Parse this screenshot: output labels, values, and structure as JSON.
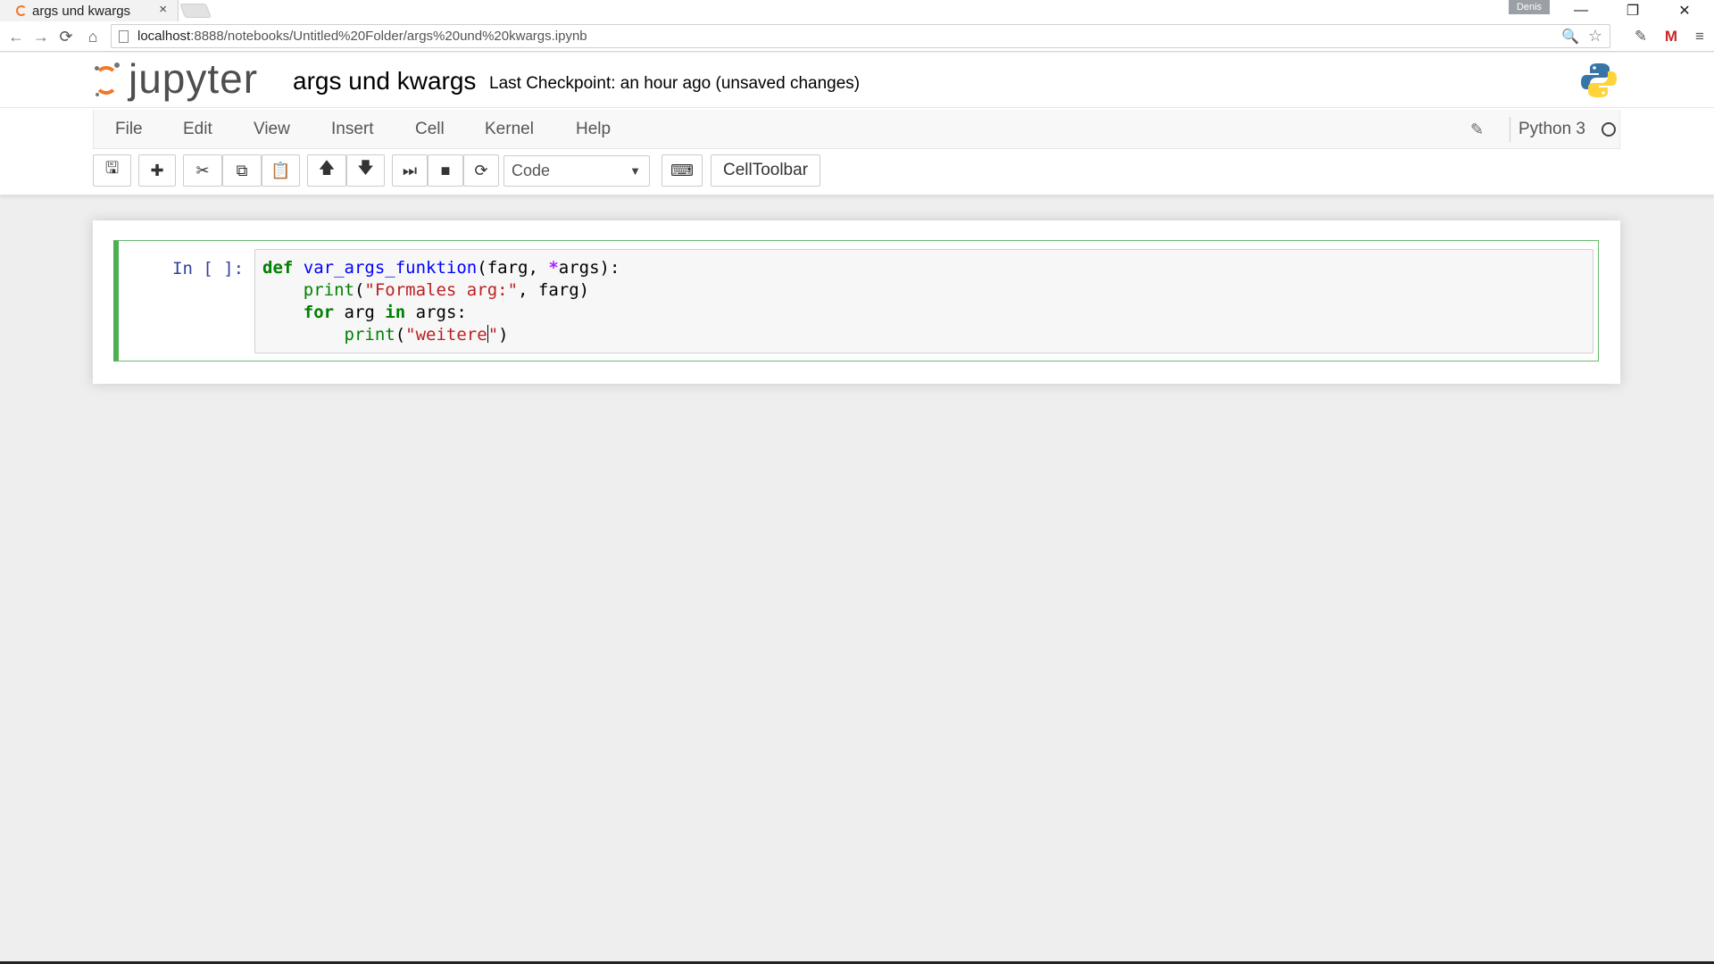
{
  "browser": {
    "tab_title": "args und kwargs",
    "tab_close": "×",
    "profile": "Denis",
    "url_host": "localhost",
    "url_rest": ":8888/notebooks/Untitled%20Folder/args%20und%20kwargs.ipynb",
    "nav_back": "←",
    "nav_forward": "→",
    "nav_reload": "⟳",
    "nav_home": "⌂",
    "win_min": "—",
    "win_restore": "❐",
    "win_close": "✕"
  },
  "header": {
    "logo_text": "jupyter",
    "notebook_name": "args und kwargs",
    "checkpoint": "Last Checkpoint: an hour ago (unsaved changes)"
  },
  "menu": {
    "items": [
      "File",
      "Edit",
      "View",
      "Insert",
      "Cell",
      "Kernel",
      "Help"
    ],
    "kernel_name": "Python 3"
  },
  "toolbar": {
    "icons": {
      "save": "🖫",
      "add": "✚",
      "cut": "✂",
      "copy": "⧉",
      "paste": "📋",
      "move_up": "🡅",
      "move_down": "🡇",
      "run": "⏭",
      "interrupt": "■",
      "restart": "⟳",
      "keyboard": "⌨"
    },
    "cell_type": "Code",
    "cell_toolbar_label": "CellToolbar"
  },
  "cell": {
    "prompt": "In [ ]:",
    "code": {
      "l1_def": "def",
      "l1_fn": "var_args_funktion",
      "l1_a": "(farg, ",
      "l1_star": "*",
      "l1_b": "args):",
      "l2_indent": "    ",
      "l2_print": "print",
      "l2_a": "(",
      "l2_str": "\"Formales arg:\"",
      "l2_b": ", farg)",
      "l3_indent": "    ",
      "l3_for": "for",
      "l3_a": " arg ",
      "l3_in": "in",
      "l3_b": " args:",
      "l4_indent": "        ",
      "l4_print": "print",
      "l4_a": "(",
      "l4_str1": "\"weitere",
      "l4_str2": "\"",
      "l4_b": ")"
    }
  },
  "colors": {
    "jupyter_orange": "#f37726",
    "cell_edit_green": "#4caf50",
    "prompt_blue": "#303f9f"
  }
}
